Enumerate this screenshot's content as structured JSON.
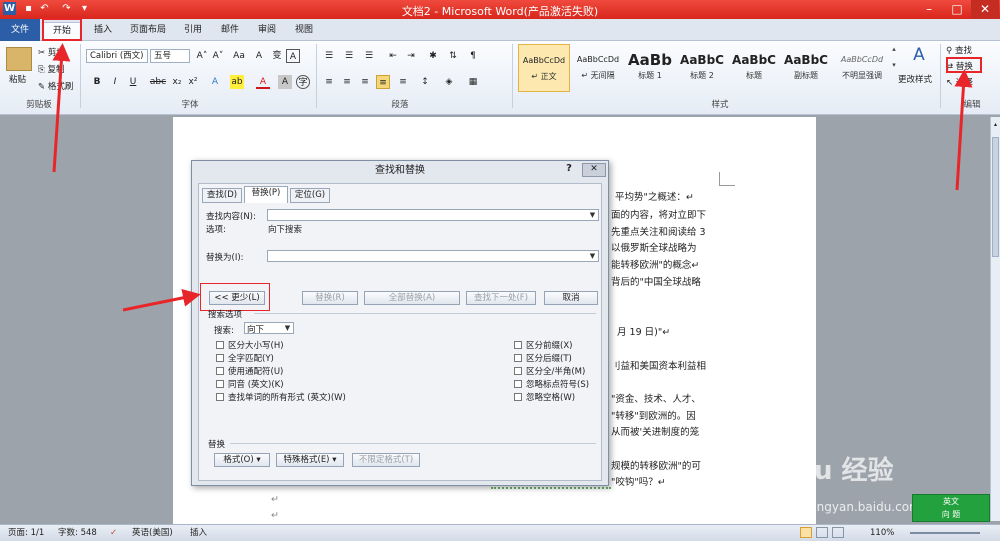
{
  "window": {
    "title": "文档2 - Microsoft Word(产品激活失败)",
    "min": "–",
    "max": "□",
    "close": "✕"
  },
  "quick_access": {
    "word_icon": "W",
    "save": "▪",
    "undo": "↶",
    "redo": "↷",
    "dropdown": "▾"
  },
  "tabs": [
    "文件",
    "开始",
    "插入",
    "页面布局",
    "引用",
    "邮件",
    "审阅",
    "视图"
  ],
  "clipboard": {
    "paste": "粘贴",
    "cut": "剪切",
    "copy": "复制",
    "format_painter": "格式刷",
    "group": "剪贴板"
  },
  "font": {
    "name": "Calibri (西文)",
    "size": "五号",
    "grow": "A˄",
    "shrink": "A˅",
    "case": "Aa",
    "clear": "A",
    "pinyin": "变",
    "border": "A",
    "group": "字体",
    "bold": "B",
    "italic": "I",
    "underline": "U",
    "strike": "abc",
    "sub": "x₂",
    "sup": "x²",
    "effects": "A",
    "highlight": "ab",
    "color": "A",
    "shade": "A",
    "circle": "字"
  },
  "paragraph": {
    "group": "段落"
  },
  "styles": {
    "group": "样式",
    "items": [
      {
        "preview": "AaBbCcDd",
        "label": "↵ 正文"
      },
      {
        "preview": "AaBbCcDd",
        "label": "↵ 无间隔"
      },
      {
        "preview": "AaBb",
        "label": "标题 1"
      },
      {
        "preview": "AaBbC",
        "label": "标题 2"
      },
      {
        "preview": "AaBbC",
        "label": "标题"
      },
      {
        "preview": "AaBbC",
        "label": "副标题"
      },
      {
        "preview": "AaBbCcDd",
        "label": "不明显强调"
      }
    ],
    "change": "更改样式"
  },
  "editing": {
    "find": "查找",
    "replace": "替换",
    "select": "选择",
    "group": "编辑"
  },
  "document": {
    "lines": [
      "平均势\"之概述：↵",
      "面的内容，将对立即下",
      "先重点关注和阅读给 3",
      "以俄罗斯全球战略为",
      "能转移欧洲\"的概念↵",
      "背后的\"中国全球战略",
      "月 19 日)\"↵",
      "刂益和美国资本利益相",
      "\"资金、技术、人才、",
      "\"转移\"到欧洲的。因",
      "从而被'关进制度的笼",
      "规模的转移欧洲\"的可",
      "\"咬钩\"吗？↵"
    ],
    "marks": [
      "↵",
      "↵",
      "↵"
    ]
  },
  "dialog": {
    "title": "查找和替换",
    "help": "?",
    "close": "✕",
    "tabs": [
      "查找(D)",
      "替换(P)",
      "定位(G)"
    ],
    "find_label": "查找内容(N):",
    "find_value": "",
    "options_label": "选项:",
    "options_value": "向下搜索",
    "replace_label": "替换为(I):",
    "replace_value": "",
    "less_button": "<< 更少(L)",
    "replace_button": "替换(R)",
    "replace_all_button": "全部替换(A)",
    "find_next_button": "查找下一处(F)",
    "cancel_button": "取消",
    "search_options": "搜索选项",
    "search_label": "搜索:",
    "search_value": "向下",
    "left_options": [
      "区分大小写(H)",
      "全字匹配(Y)",
      "使用通配符(U)",
      "同音 (英文)(K)",
      "查找单词的所有形式 (英文)(W)"
    ],
    "right_options": [
      "区分前缀(X)",
      "区分后缀(T)",
      "区分全/半角(M)",
      "忽略标点符号(S)",
      "忽略空格(W)"
    ],
    "replace_section": "替换",
    "format_button": "格式(O) ▾",
    "special_button": "特殊格式(E) ▾",
    "no_format_button": "不限定格式(T)"
  },
  "status": {
    "page": "页面: 1/1",
    "words": "字数: 548",
    "lang": "英语(美国)",
    "mode": "插入",
    "zoom": "110%"
  },
  "watermark": {
    "brand": "Bai du 经验",
    "url": "jingyan.baidu.com",
    "badge_top": "英文",
    "badge_bottom": "向 题"
  },
  "colors": {
    "title_red": "#e02a1f",
    "file_blue": "#2c5ea8",
    "annotation_red": "#e8262a"
  }
}
